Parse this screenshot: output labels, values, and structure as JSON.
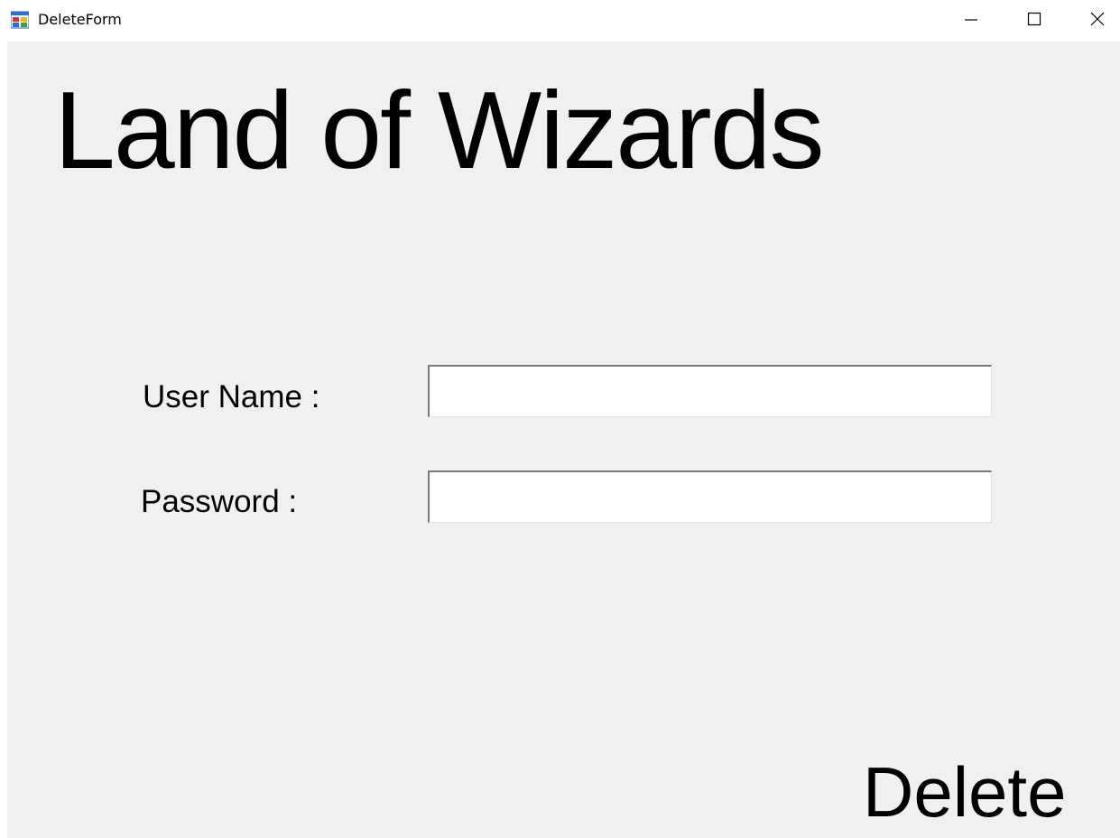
{
  "window": {
    "title": "DeleteForm",
    "icon": "winforms-app-icon",
    "controls": {
      "minimize_icon": "minimize-icon",
      "maximize_icon": "maximize-icon",
      "close_icon": "close-icon"
    }
  },
  "form": {
    "heading": "Land of Wizards",
    "username_label": "User Name :",
    "username_value": "",
    "password_label": "Password :",
    "password_value": "",
    "delete_label": "Delete"
  },
  "colors": {
    "client_background": "#f0f0f0",
    "titlebar_background": "#ffffff",
    "text": "#000000",
    "field_background": "#ffffff"
  }
}
